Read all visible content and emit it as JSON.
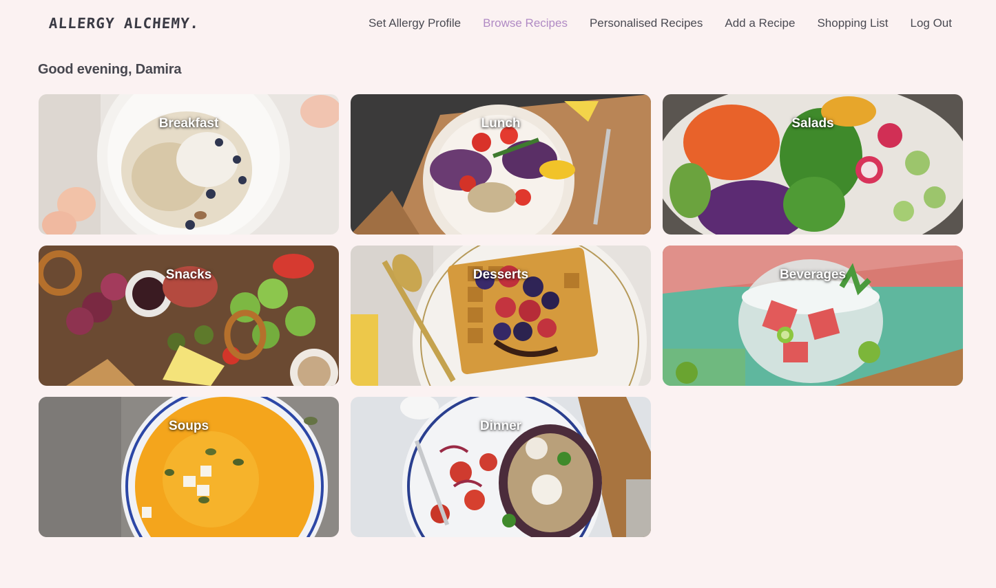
{
  "brand": {
    "name": "ALLERGY ALCHEMY."
  },
  "nav": {
    "items": [
      {
        "label": "Set Allergy Profile",
        "active": false
      },
      {
        "label": "Browse Recipes",
        "active": true
      },
      {
        "label": "Personalised Recipes",
        "active": false
      },
      {
        "label": "Add a Recipe",
        "active": false
      },
      {
        "label": "Shopping List",
        "active": false
      },
      {
        "label": "Log Out",
        "active": false
      }
    ]
  },
  "greeting": "Good evening, Damira",
  "categories": [
    {
      "label": "Breakfast",
      "image": "oatmeal-bowl-image"
    },
    {
      "label": "Lunch",
      "image": "salad-plate-image"
    },
    {
      "label": "Salads",
      "image": "vegetable-salad-image"
    },
    {
      "label": "Snacks",
      "image": "snack-board-image"
    },
    {
      "label": "Desserts",
      "image": "waffle-berries-image"
    },
    {
      "label": "Beverages",
      "image": "watermelon-drink-image"
    },
    {
      "label": "Soups",
      "image": "pumpkin-soup-image"
    },
    {
      "label": "Dinner",
      "image": "stuffed-eggplant-image"
    }
  ],
  "colors": {
    "background": "#fbf2f2",
    "accent": "#b08ac4",
    "text": "#4a4a52"
  }
}
